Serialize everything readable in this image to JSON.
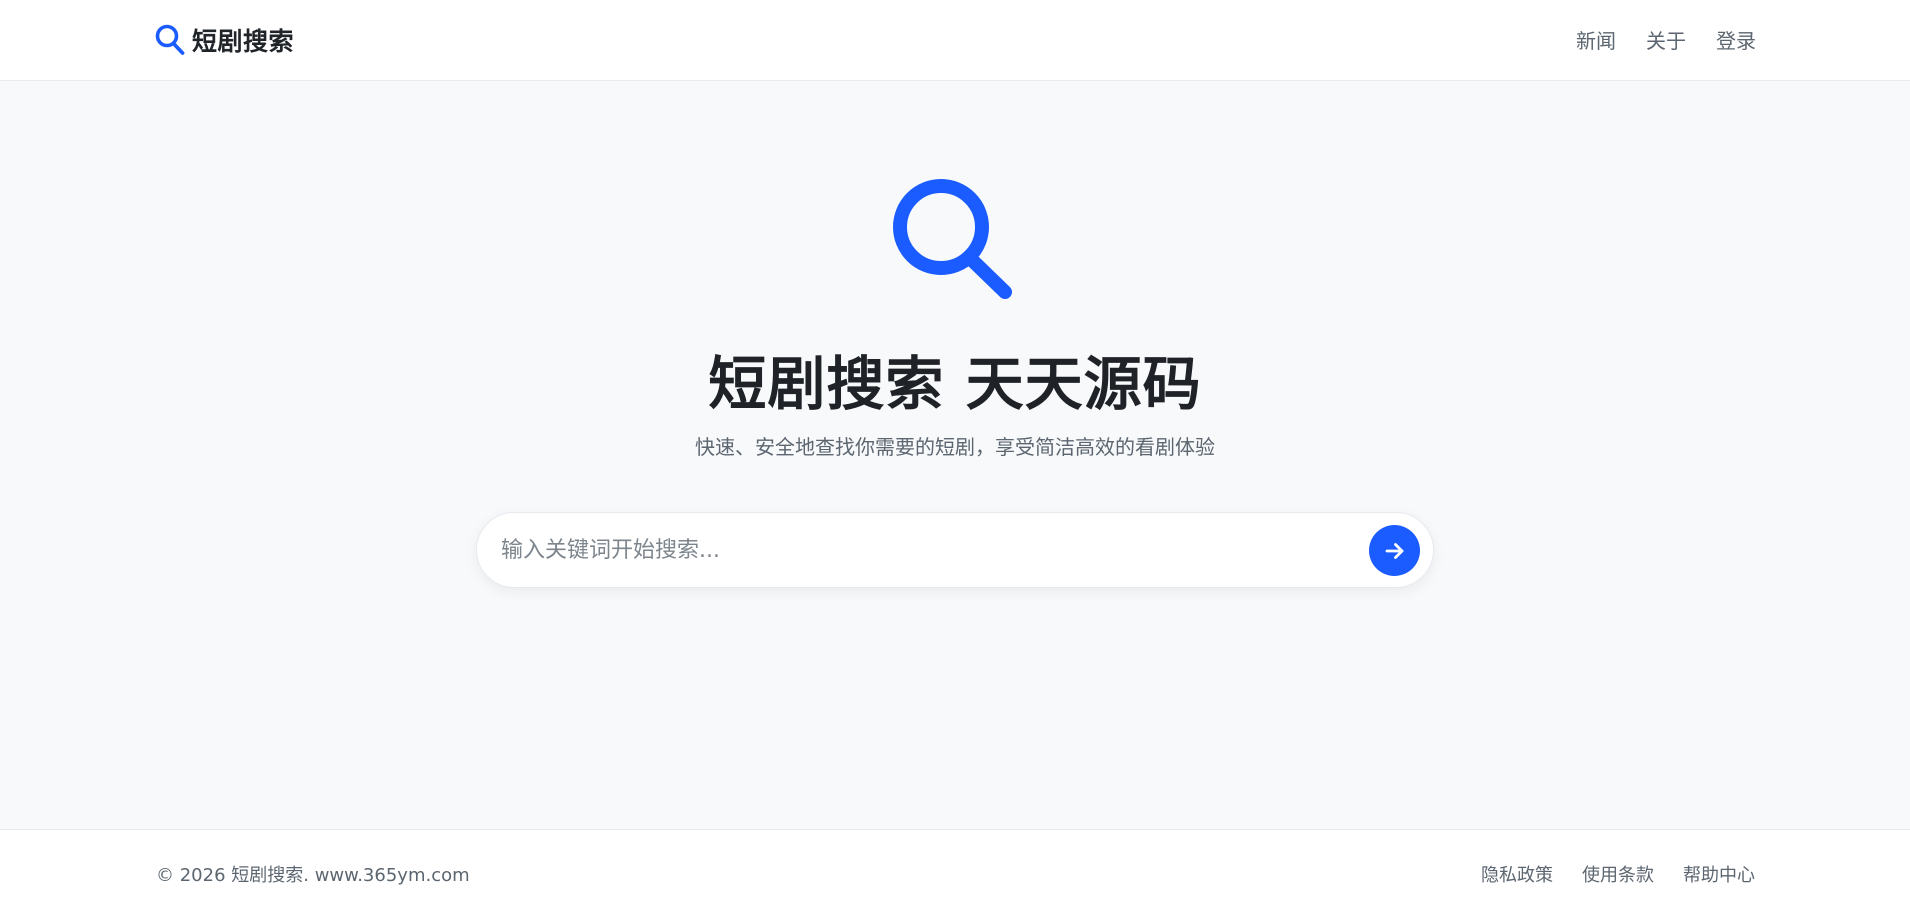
{
  "colors": {
    "accent": "#1a5cff",
    "page_background": "#f8f9fb",
    "header_background": "#ffffff",
    "title_text": "#1f2328",
    "muted_text": "#5c6670"
  },
  "header": {
    "brand_icon": "search-icon",
    "brand_name": "短剧搜索",
    "nav": [
      "新闻",
      "关于",
      "登录"
    ]
  },
  "hero": {
    "icon": "search-icon",
    "title": "短剧搜索 天天源码",
    "subtitle": "快速、安全地查找你需要的短剧，享受简洁高效的看剧体验"
  },
  "search": {
    "placeholder": "输入关键词开始搜索...",
    "value": "",
    "submit_icon": "arrow-right-icon"
  },
  "footer": {
    "copyright": "© 2026 短剧搜索. www.365ym.com",
    "links": [
      "隐私政策",
      "使用条款",
      "帮助中心"
    ]
  }
}
